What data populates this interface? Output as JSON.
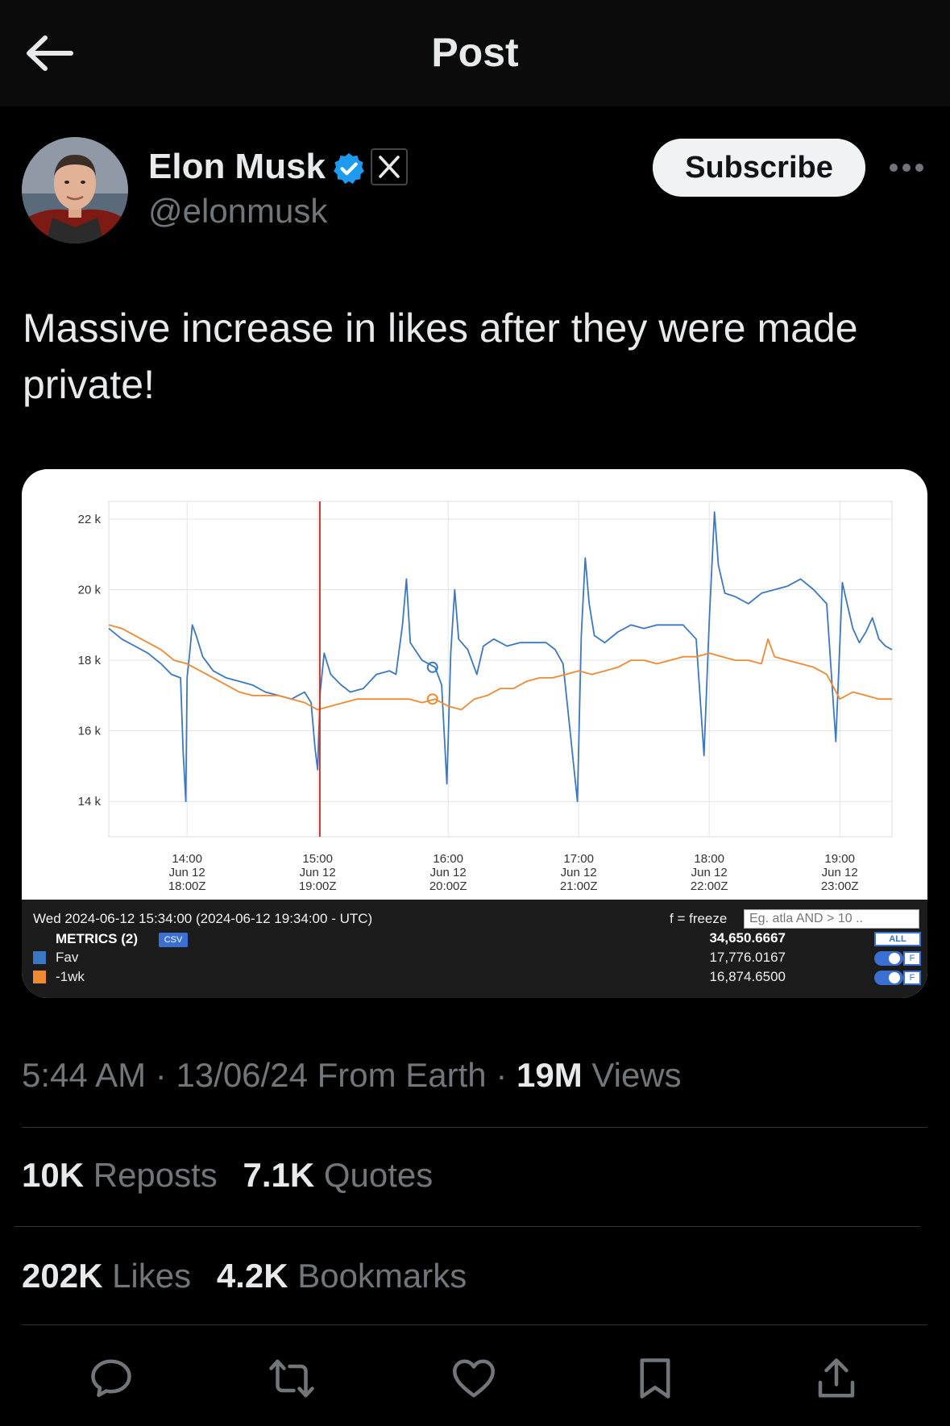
{
  "header": {
    "title": "Post",
    "back_icon": "arrow-left-icon"
  },
  "author": {
    "name": "Elon Musk",
    "handle": "@elonmusk",
    "verified_color": "#1d9bf0",
    "subscribe_label": "Subscribe"
  },
  "post": {
    "text": "Massive increase in likes after they were made private!",
    "time": "5:44 AM",
    "date": "13/06/24",
    "source": "From Earth",
    "views_count": "19M",
    "views_label": "Views"
  },
  "stats": {
    "reposts_count": "10K",
    "reposts_label": "Reposts",
    "quotes_count": "7.1K",
    "quotes_label": "Quotes",
    "likes_count": "202K",
    "likes_label": "Likes",
    "bookmarks_count": "4.2K",
    "bookmarks_label": "Bookmarks"
  },
  "actions": [
    "reply-icon",
    "repost-icon",
    "like-icon",
    "bookmark-icon",
    "share-icon"
  ],
  "legend": {
    "datetime": "Wed 2024-06-12 15:34:00 (2024-06-12 19:34:00 - UTC)",
    "metrics_label": "METRICS (2)",
    "csv_label": "CSV",
    "freeze_label": "f = freeze",
    "filter_placeholder": "Eg. atla AND > 10 ..",
    "total": "34,650.6667",
    "all_label": "ALL",
    "f_label": "F",
    "series": [
      {
        "name": "Fav",
        "value": "17,776.0167",
        "color": "#3b78c3"
      },
      {
        "name": "-1wk",
        "value": "16,874.6500",
        "color": "#ef8a32"
      }
    ]
  },
  "chart_data": {
    "type": "line",
    "y_ticks": [
      "22 k",
      "20 k",
      "18 k",
      "16 k",
      "14 k"
    ],
    "ylim": [
      13000,
      22500
    ],
    "x_ticks": [
      {
        "t": 14,
        "line1": "14:00",
        "line2": "Jun 12",
        "line3": "18:00Z"
      },
      {
        "t": 15,
        "line1": "15:00",
        "line2": "Jun 12",
        "line3": "19:00Z"
      },
      {
        "t": 16,
        "line1": "16:00",
        "line2": "Jun 12",
        "line3": "20:00Z"
      },
      {
        "t": 17,
        "line1": "17:00",
        "line2": "Jun 12",
        "line3": "21:00Z"
      },
      {
        "t": 18,
        "line1": "18:00",
        "line2": "Jun 12",
        "line3": "22:00Z"
      },
      {
        "t": 19,
        "line1": "19:00",
        "line2": "Jun 12",
        "line3": "23:00Z"
      }
    ],
    "xlim": [
      13.4,
      19.4
    ],
    "cursor_time": 15.0167,
    "grid": true,
    "series": [
      {
        "name": "Fav",
        "color": "#3b78c3",
        "points": [
          [
            13.4,
            18900
          ],
          [
            13.5,
            18600
          ],
          [
            13.6,
            18400
          ],
          [
            13.7,
            18200
          ],
          [
            13.8,
            17900
          ],
          [
            13.88,
            17600
          ],
          [
            13.95,
            17500
          ],
          [
            13.97,
            15400
          ],
          [
            13.99,
            14000
          ],
          [
            14.0,
            17500
          ],
          [
            14.02,
            18200
          ],
          [
            14.04,
            19000
          ],
          [
            14.07,
            18700
          ],
          [
            14.12,
            18100
          ],
          [
            14.2,
            17700
          ],
          [
            14.3,
            17500
          ],
          [
            14.4,
            17400
          ],
          [
            14.5,
            17300
          ],
          [
            14.6,
            17100
          ],
          [
            14.7,
            17000
          ],
          [
            14.8,
            16900
          ],
          [
            14.9,
            17100
          ],
          [
            14.95,
            16800
          ],
          [
            14.98,
            15500
          ],
          [
            15.0,
            14900
          ],
          [
            15.02,
            17100
          ],
          [
            15.05,
            18200
          ],
          [
            15.1,
            17600
          ],
          [
            15.18,
            17300
          ],
          [
            15.25,
            17100
          ],
          [
            15.35,
            17200
          ],
          [
            15.45,
            17600
          ],
          [
            15.55,
            17700
          ],
          [
            15.6,
            17600
          ],
          [
            15.65,
            19000
          ],
          [
            15.68,
            20300
          ],
          [
            15.71,
            18500
          ],
          [
            15.8,
            18000
          ],
          [
            15.9,
            17800
          ],
          [
            15.95,
            17300
          ],
          [
            15.99,
            14500
          ],
          [
            16.02,
            18200
          ],
          [
            16.05,
            20000
          ],
          [
            16.08,
            18600
          ],
          [
            16.15,
            18300
          ],
          [
            16.22,
            17600
          ],
          [
            16.27,
            18400
          ],
          [
            16.35,
            18600
          ],
          [
            16.45,
            18400
          ],
          [
            16.55,
            18500
          ],
          [
            16.65,
            18500
          ],
          [
            16.75,
            18500
          ],
          [
            16.82,
            18300
          ],
          [
            16.88,
            17900
          ],
          [
            16.99,
            14000
          ],
          [
            17.02,
            18700
          ],
          [
            17.05,
            20900
          ],
          [
            17.08,
            19600
          ],
          [
            17.12,
            18700
          ],
          [
            17.2,
            18500
          ],
          [
            17.3,
            18800
          ],
          [
            17.4,
            19000
          ],
          [
            17.5,
            18900
          ],
          [
            17.6,
            19000
          ],
          [
            17.7,
            19000
          ],
          [
            17.8,
            19000
          ],
          [
            17.9,
            18600
          ],
          [
            17.96,
            15300
          ],
          [
            18.0,
            19100
          ],
          [
            18.04,
            22200
          ],
          [
            18.07,
            20700
          ],
          [
            18.12,
            19900
          ],
          [
            18.2,
            19800
          ],
          [
            18.3,
            19600
          ],
          [
            18.4,
            19900
          ],
          [
            18.5,
            20000
          ],
          [
            18.6,
            20100
          ],
          [
            18.7,
            20300
          ],
          [
            18.8,
            20000
          ],
          [
            18.9,
            19600
          ],
          [
            18.97,
            15700
          ],
          [
            19.02,
            20200
          ],
          [
            19.05,
            19700
          ],
          [
            19.1,
            18900
          ],
          [
            19.15,
            18500
          ],
          [
            19.2,
            18800
          ],
          [
            19.25,
            19200
          ],
          [
            19.3,
            18600
          ],
          [
            19.35,
            18400
          ],
          [
            19.4,
            18300
          ]
        ]
      },
      {
        "name": "-1wk",
        "color": "#ef8a32",
        "points": [
          [
            13.4,
            19000
          ],
          [
            13.5,
            18900
          ],
          [
            13.6,
            18700
          ],
          [
            13.7,
            18500
          ],
          [
            13.8,
            18300
          ],
          [
            13.9,
            18000
          ],
          [
            14.0,
            17900
          ],
          [
            14.1,
            17700
          ],
          [
            14.2,
            17500
          ],
          [
            14.3,
            17300
          ],
          [
            14.4,
            17100
          ],
          [
            14.5,
            17000
          ],
          [
            14.6,
            17000
          ],
          [
            14.7,
            17000
          ],
          [
            14.8,
            16900
          ],
          [
            14.9,
            16800
          ],
          [
            15.0,
            16600
          ],
          [
            15.1,
            16700
          ],
          [
            15.2,
            16800
          ],
          [
            15.3,
            16900
          ],
          [
            15.4,
            16900
          ],
          [
            15.5,
            16900
          ],
          [
            15.6,
            16900
          ],
          [
            15.7,
            16900
          ],
          [
            15.8,
            16800
          ],
          [
            15.9,
            16900
          ],
          [
            16.0,
            16700
          ],
          [
            16.1,
            16600
          ],
          [
            16.2,
            16900
          ],
          [
            16.3,
            17000
          ],
          [
            16.4,
            17200
          ],
          [
            16.5,
            17200
          ],
          [
            16.6,
            17400
          ],
          [
            16.7,
            17500
          ],
          [
            16.8,
            17500
          ],
          [
            16.9,
            17600
          ],
          [
            17.0,
            17700
          ],
          [
            17.1,
            17600
          ],
          [
            17.2,
            17700
          ],
          [
            17.3,
            17800
          ],
          [
            17.4,
            18000
          ],
          [
            17.5,
            18000
          ],
          [
            17.6,
            17900
          ],
          [
            17.7,
            18000
          ],
          [
            17.8,
            18100
          ],
          [
            17.9,
            18100
          ],
          [
            18.0,
            18200
          ],
          [
            18.1,
            18100
          ],
          [
            18.2,
            18000
          ],
          [
            18.3,
            18000
          ],
          [
            18.4,
            17900
          ],
          [
            18.45,
            18600
          ],
          [
            18.5,
            18100
          ],
          [
            18.6,
            18000
          ],
          [
            18.7,
            17900
          ],
          [
            18.8,
            17800
          ],
          [
            18.9,
            17600
          ],
          [
            19.0,
            16900
          ],
          [
            19.1,
            17100
          ],
          [
            19.2,
            17000
          ],
          [
            19.3,
            16900
          ],
          [
            19.4,
            16900
          ]
        ]
      }
    ]
  }
}
